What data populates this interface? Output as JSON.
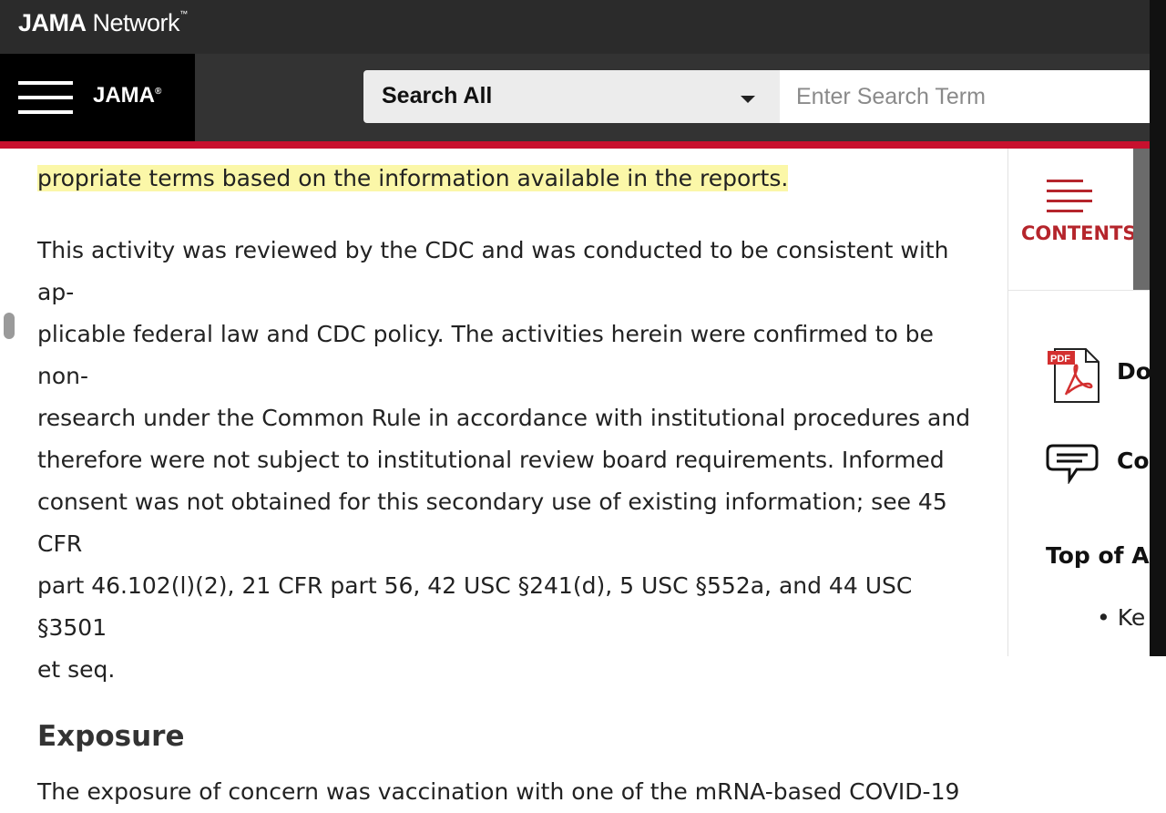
{
  "header": {
    "brand_main": "JAMA",
    "brand_rest": "Network",
    "brand_tm": "™",
    "journal": "JAMA",
    "journal_reg": "®"
  },
  "search": {
    "scope_label": "Search All",
    "placeholder": "Enter Search Term"
  },
  "article": {
    "partial_line": "",
    "highlighted_text": "propriate terms based on the information available in the reports.",
    "paragraph_lines": [
      "This activity was reviewed by the CDC and was conducted to be consistent with ap-",
      "plicable federal law and CDC policy. The activities herein were confirmed to be non-",
      "research under the Common Rule in accordance with institutional procedures and",
      "therefore were not subject to institutional review board requirements. Informed",
      "consent was not obtained for this secondary use of existing information; see 45 CFR",
      "part 46.102(l)(2), 21 CFR part 56, 42 USC §241(d), 5 USC §552a, and 44 USC §3501",
      "et seq."
    ],
    "section_heading": "Exposure",
    "next_paragraph": "The exposure of concern was vaccination with one of the mRNA-based COVID-19"
  },
  "sidebar": {
    "contents_label": "CONTENTS",
    "download_label": "Do",
    "comment_label": "Co",
    "top_heading": "Top of Ar",
    "bullet_item": "Ke",
    "colors": {
      "accent": "#b5252c",
      "highlight": "#fbf7a8",
      "brand_red": "#c8102e"
    },
    "icons": [
      "contents-icon",
      "pdf-icon",
      "comment-icon"
    ]
  }
}
